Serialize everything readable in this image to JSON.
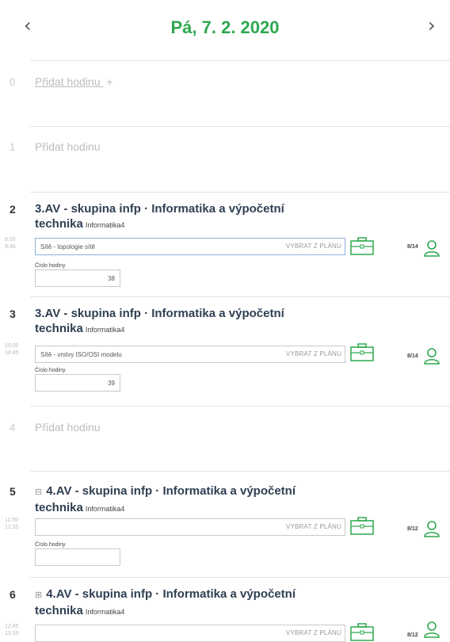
{
  "header": {
    "prev": "‹",
    "next": "›",
    "date": "Pá, 7. 2. 2020"
  },
  "colors": {
    "accent": "#2fa84f",
    "title": "#2f3f52",
    "faded": "#bdbdbd"
  },
  "labels": {
    "plan": "VYBRAT Z PLÁNU",
    "lesson_number_label": "Číslo hodiny"
  },
  "periods": [
    {
      "num": "0",
      "add": "Přidat hodinu",
      "add_suffix": "+"
    },
    {
      "num": "1",
      "add": "Přidat hodinu"
    },
    {
      "num": "2",
      "title": "3.AV - skupina infp · Informatika a výpočetní technika",
      "room": "Informatika4",
      "time_start": "8:55",
      "time_end": "9:40",
      "topic": "Sítě - topologie sítě",
      "count": "8/14",
      "lesson_number": "38"
    },
    {
      "num": "3",
      "title": "3.AV - skupina infp · Informatika a výpočetní technika",
      "room": "Informatika4",
      "time_start": "10:00",
      "time_end": "10:45",
      "topic": "Sítě - vrstvy ISO/OSI modelu",
      "count": "8/14",
      "lesson_number": "39"
    },
    {
      "num": "4",
      "add": "Přidat hodinu"
    },
    {
      "num": "5",
      "title": "4.AV - skupina infp · Informatika a výpočetní technika",
      "room": "Informatika4",
      "time_start": "11:50",
      "time_end": "12:35",
      "topic": "",
      "count": "8/12",
      "lesson_number": ""
    },
    {
      "num": "6",
      "title": "4.AV - skupina infp · Informatika a výpočetní technika",
      "room": "Informatika4",
      "time_start": "12:45",
      "time_end": "13:30",
      "topic": "",
      "count": "8/12"
    }
  ],
  "icons": {
    "prev": "chevron-left-icon",
    "next": "chevron-right-icon",
    "bag": "briefcase-icon",
    "person": "person-icon",
    "expand": "expand-icon"
  }
}
